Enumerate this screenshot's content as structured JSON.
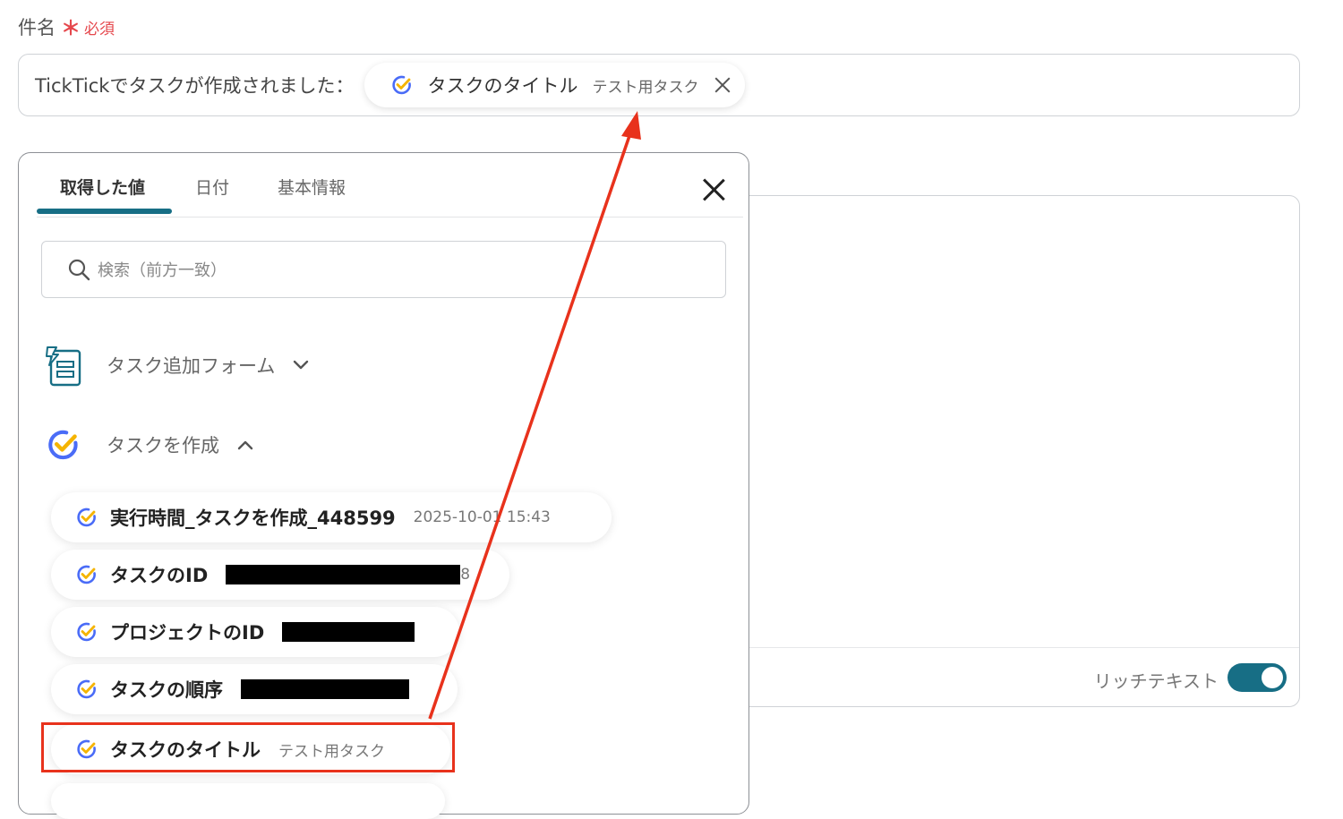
{
  "field": {
    "label": "件名",
    "required_star": "＊",
    "required_text": "必須"
  },
  "subject_input": {
    "text": "TickTickでタスクが作成されました：",
    "pill": {
      "name": "タスクのタイトル",
      "value": "テスト用タスク",
      "icon": "ticktick-check-icon"
    }
  },
  "body_editor": {
    "rich_text_label": "リッチテキスト",
    "rich_text_enabled": true
  },
  "popup": {
    "tabs": [
      {
        "label": "取得した値",
        "active": true
      },
      {
        "label": "日付",
        "active": false
      },
      {
        "label": "基本情報",
        "active": false
      }
    ],
    "search_placeholder": "検索（前方一致）",
    "sections": [
      {
        "title": "タスク追加フォーム",
        "expanded": false,
        "icon": "form-icon"
      },
      {
        "title": "タスクを作成",
        "expanded": true,
        "icon": "ticktick-check-icon"
      }
    ],
    "items": [
      {
        "name": "実行時間_タスクを作成_448599",
        "value": "2025-10-01 15:43"
      },
      {
        "name": "タスクのID",
        "value": "8",
        "redacted": true
      },
      {
        "name": "プロジェクトのID",
        "value": "",
        "redacted": true
      },
      {
        "name": "タスクの順序",
        "value": "",
        "redacted": true
      },
      {
        "name": "タスクのタイトル",
        "value": "テスト用タスク",
        "highlighted": true
      }
    ]
  },
  "colors": {
    "accent": "#176e85",
    "required": "#e5484d",
    "annotation": "#e8321c",
    "check_blue": "#4a6cf7",
    "check_yellow": "#f5b400"
  }
}
